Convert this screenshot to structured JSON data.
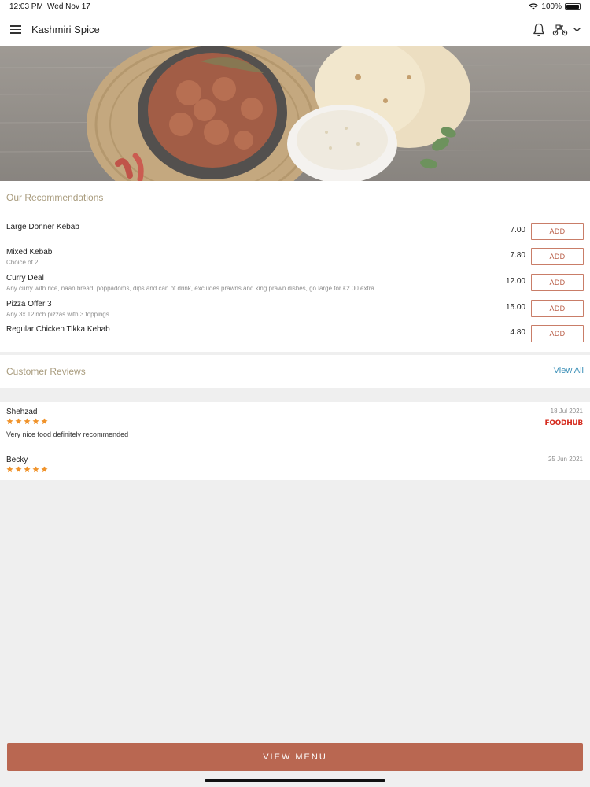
{
  "status_bar": {
    "time": "12:03 PM",
    "date": "Wed Nov 17",
    "battery": "100%"
  },
  "app_bar": {
    "title": "Kashmiri Spice",
    "icons": [
      "menu-icon",
      "bell-icon",
      "scooter-icon",
      "chevron-down-icon"
    ]
  },
  "recommendations": {
    "title": "Our Recommendations",
    "items": [
      {
        "name": "Large Donner Kebab",
        "desc": "",
        "price": "7.00",
        "button": "ADD"
      },
      {
        "name": "Mixed Kebab",
        "desc": "Choice of 2",
        "price": "7.80",
        "button": "ADD"
      },
      {
        "name": "Curry Deal",
        "desc": "Any curry with rice, naan bread, poppadoms, dips and can of drink, excludes prawns and king prawn dishes, go large for £2.00 extra",
        "price": "12.00",
        "button": "ADD"
      },
      {
        "name": "Pizza Offer 3",
        "desc": "Any 3x 12inch pizzas with 3 toppings",
        "price": "15.00",
        "button": "ADD"
      },
      {
        "name": "Regular Chicken Tikka Kebab",
        "desc": "",
        "price": "4.80",
        "button": "ADD"
      }
    ]
  },
  "reviews": {
    "title": "Customer Reviews",
    "view_all": "View All",
    "items": [
      {
        "name": "Shehzad",
        "date": "18 Jul 2021",
        "rating": 5,
        "text": "Very nice food definitely recommended",
        "source": "FOODHUB"
      },
      {
        "name": "Becky",
        "date": "25 Jun 2021",
        "rating": 5,
        "text": "",
        "source": ""
      }
    ]
  },
  "footer": {
    "view_menu": "VIEW MENU"
  },
  "colors": {
    "accent": "#b96751",
    "star": "#f0932b",
    "link": "#3a8fb7",
    "section_title": "#a99c7e"
  }
}
